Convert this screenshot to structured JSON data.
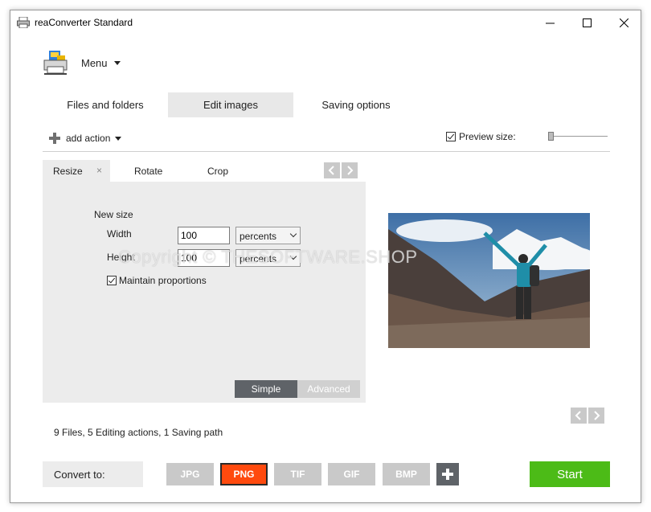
{
  "window": {
    "title": "reaConverter Standard"
  },
  "menu": {
    "label": "Menu"
  },
  "tabs": [
    {
      "label": "Files and folders",
      "active": false
    },
    {
      "label": "Edit images",
      "active": true
    },
    {
      "label": "Saving options",
      "active": false
    }
  ],
  "action_bar": {
    "add_action_label": "add action",
    "preview_size_label": "Preview size:",
    "preview_size_checked": true
  },
  "edit_panel": {
    "subtabs": [
      {
        "label": "Resize",
        "active": true,
        "close": "×"
      },
      {
        "label": "Rotate",
        "active": false
      },
      {
        "label": "Crop",
        "active": false
      }
    ],
    "new_size_label": "New size",
    "width_label": "Width",
    "width_value": "100",
    "width_unit": "percents",
    "height_label": "Height",
    "height_value": "100",
    "height_unit": "percents",
    "maintain_label": "Maintain proportions",
    "maintain_checked": true,
    "mode_simple": "Simple",
    "mode_advanced": "Advanced"
  },
  "watermark": "Copyright © THESOFTWARE.SHOP",
  "status": {
    "files_text": "9 Files,",
    "actions_text": "5 Editing actions,",
    "paths_text": "1 Saving path"
  },
  "bottom": {
    "convert_to_label": "Convert to:",
    "formats": [
      {
        "label": "JPG",
        "active": false
      },
      {
        "label": "PNG",
        "active": true
      },
      {
        "label": "TIF",
        "active": false
      },
      {
        "label": "GIF",
        "active": false
      },
      {
        "label": "BMP",
        "active": false
      }
    ],
    "start_label": "Start"
  },
  "colors": {
    "accent_png": "#ff4a0e",
    "start_green": "#4cbb17",
    "panel_gray": "#ececec"
  }
}
